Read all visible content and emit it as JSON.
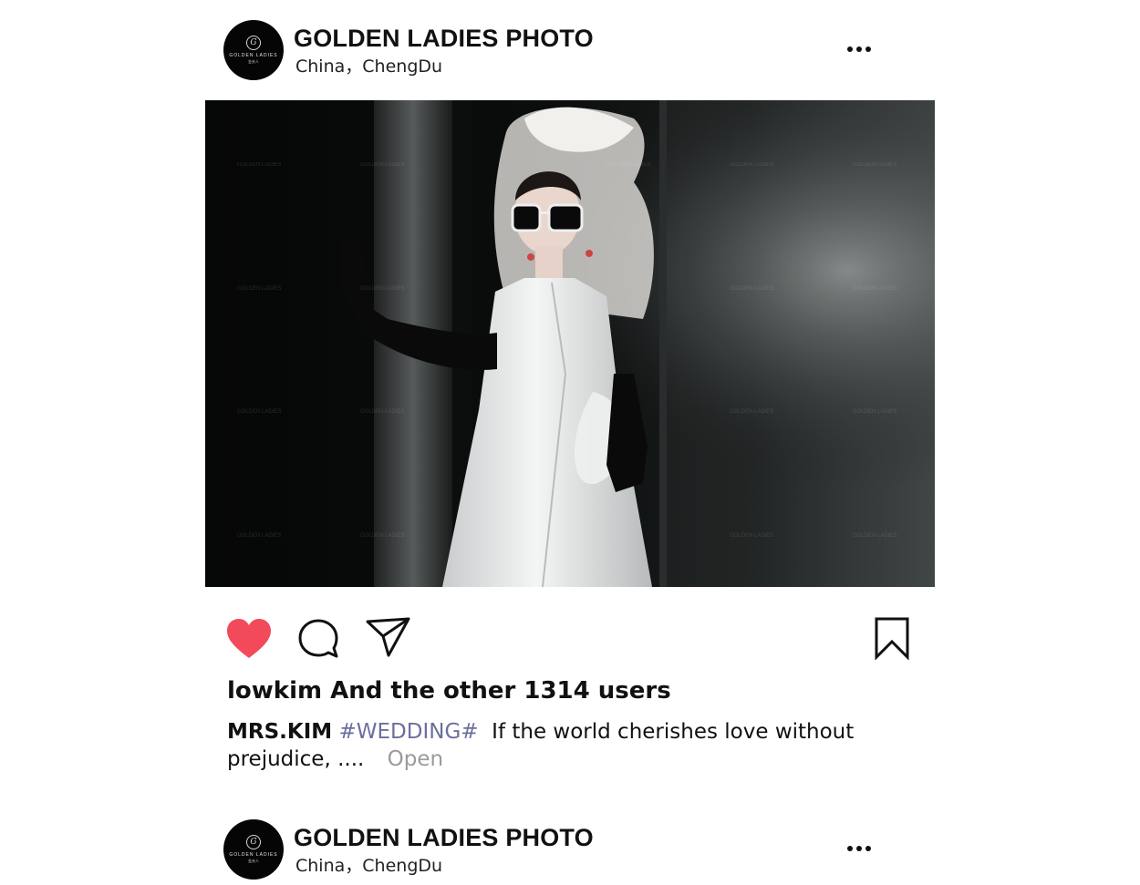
{
  "posts": [
    {
      "account_name": "GOLDEN LADIES PHOTO",
      "location": "China，ChengDu",
      "avatar": {
        "mark": "G",
        "text": "GOLDEN LADIES",
        "sub": "金夫人"
      },
      "more_icon": "more-horizontal-icon"
    },
    {
      "account_name": "GOLDEN LADIES PHOTO",
      "location": "China，ChengDu",
      "avatar": {
        "mark": "G",
        "text": "GOLDEN LADIES",
        "sub": "金夫人"
      },
      "more_icon": "more-horizontal-icon"
    }
  ],
  "photo": {
    "watermark_text": "GOLDEN LADIES",
    "description_icon": "photo-image"
  },
  "actions": {
    "like_icon": "heart-icon",
    "comment_icon": "comment-icon",
    "share_icon": "send-icon",
    "save_icon": "bookmark-icon",
    "liked": true
  },
  "likes_text": "lowkim And the other 1314 users",
  "caption": {
    "user": "MRS.KIM",
    "hashtag": "#WEDDING#",
    "text": "If the world cherishes love without prejudice, ....",
    "open_label": "Open"
  },
  "colors": {
    "like_red": "#f24a5a",
    "hashtag": "#6b6f9e",
    "open_gray": "#9a9a9a"
  }
}
